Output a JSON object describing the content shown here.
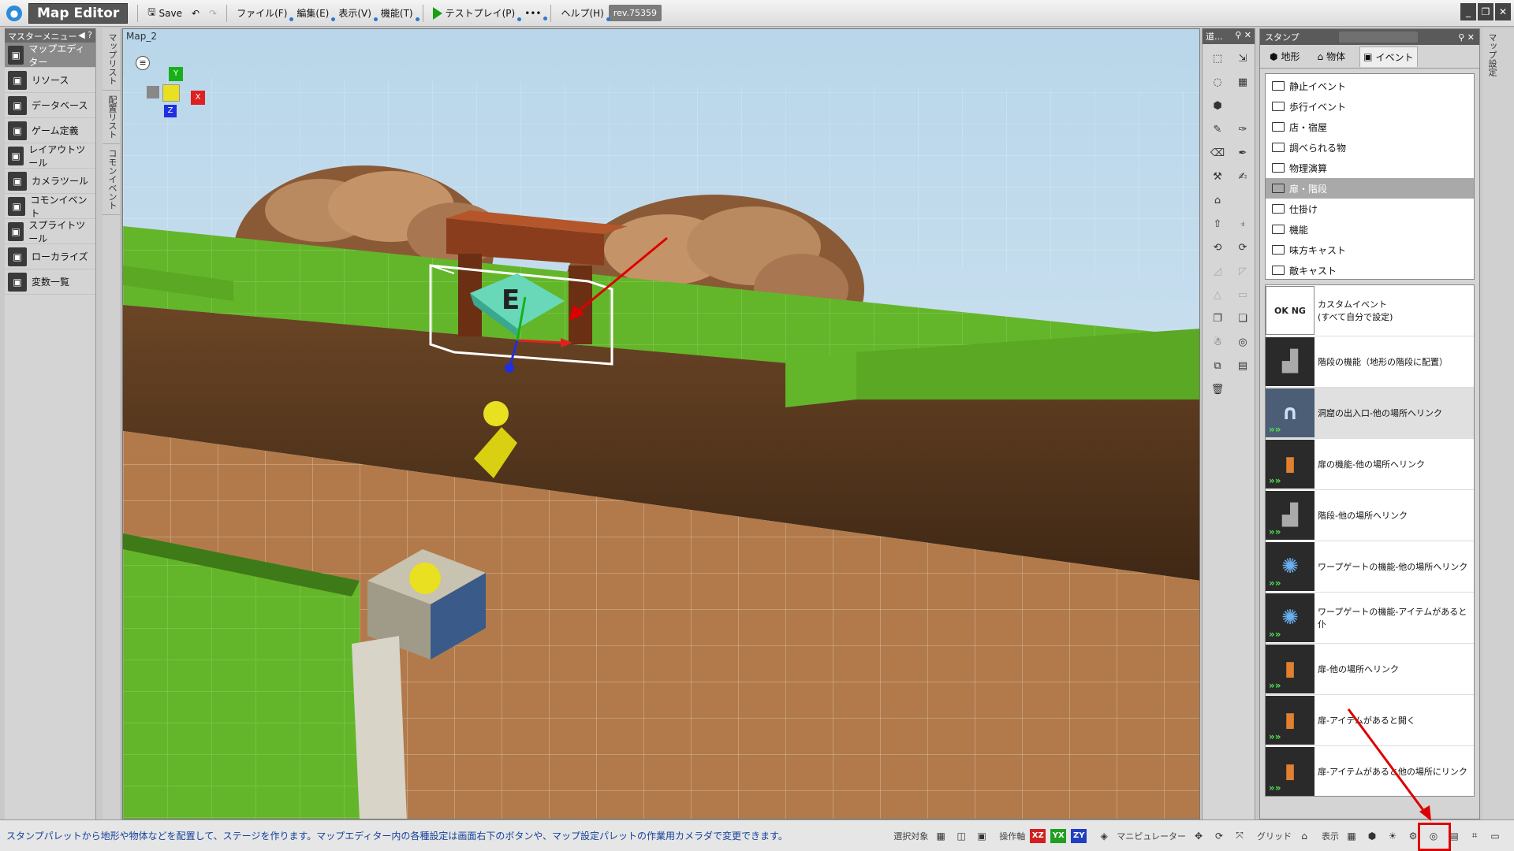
{
  "titlebar": {
    "app_title": "Map Editor",
    "save_label": "Save",
    "menus": [
      "ファイル(F)",
      "編集(E)",
      "表示(V)",
      "機能(T)"
    ],
    "testplay_label": "テストプレイ(P)",
    "more_label": "•••",
    "help_label": "ヘルプ(H)",
    "revision": "rev.75359"
  },
  "master_menu": {
    "title": "マスターメニュー",
    "items": [
      {
        "label": "マップエディター",
        "icon": "map-editor-icon"
      },
      {
        "label": "リソース",
        "icon": "resource-icon"
      },
      {
        "label": "データベース",
        "icon": "database-icon"
      },
      {
        "label": "ゲーム定義",
        "icon": "game-definition-icon"
      },
      {
        "label": "レイアウトツール",
        "icon": "layout-tool-icon"
      },
      {
        "label": "カメラツール",
        "icon": "camera-tool-icon"
      },
      {
        "label": "コモンイベント",
        "icon": "common-event-icon"
      },
      {
        "label": "スプライトツール",
        "icon": "sprite-tool-icon"
      },
      {
        "label": "ローカライズ",
        "icon": "localize-icon"
      },
      {
        "label": "変数一覧",
        "icon": "variables-icon"
      }
    ]
  },
  "side_tabs": [
    "マップリスト",
    "配置リスト",
    "コモンイベント"
  ],
  "viewport": {
    "map_name": "Map_2",
    "gizmo_labels": [
      "Y",
      "X",
      "Z"
    ],
    "event_letter": "E"
  },
  "tool_palette": {
    "title": "道..."
  },
  "stamp": {
    "title": "スタンプ",
    "tabs": [
      "地形",
      "物体",
      "イベント"
    ],
    "categories": [
      "静止イベント",
      "歩行イベント",
      "店・宿屋",
      "調べられる物",
      "物理演算",
      "扉・階段",
      "仕掛け",
      "機能",
      "味方キャスト",
      "敵キャスト"
    ],
    "selected_category": "扉・階段",
    "events": [
      {
        "label": "カスタムイベント\n(すべて自分で設定)",
        "kind": "custom"
      },
      {
        "label": "階段の機能（地形の階段に配置）",
        "kind": "stairs"
      },
      {
        "label": "洞窟の出入口-他の場所へリンク",
        "kind": "cave"
      },
      {
        "label": "扉の機能-他の場所へリンク",
        "kind": "door"
      },
      {
        "label": "階段-他の場所へリンク",
        "kind": "stairs"
      },
      {
        "label": "ワープゲートの機能-他の場所へリンク",
        "kind": "warp"
      },
      {
        "label": "ワープゲートの機能-アイテムがあると仆",
        "kind": "warp"
      },
      {
        "label": "扉-他の場所へリンク",
        "kind": "door"
      },
      {
        "label": "扉-アイテムがあると開く",
        "kind": "door"
      },
      {
        "label": "扉-アイテムがあると他の場所にリンク",
        "kind": "door"
      }
    ]
  },
  "right_side_tab": "マップ設定",
  "statusbar": {
    "message": "スタンプパレットから地形や物体などを配置して、ステージを作ります。マップエディター内の各種設定は画面右下のボタンや、マップ設定パレットの作業用カメラダで変更できます。",
    "select_target_label": "選択対象",
    "axis_label": "操作軸",
    "axis_buttons": [
      "XZ",
      "YX",
      "ZY"
    ],
    "manipulator_label": "マニピュレーター",
    "grid_label": "グリッド",
    "display_label": "表示"
  },
  "colors": {
    "sky": "#cfe4f2",
    "grass": "#63b62a",
    "dirt": "#b27a4a",
    "highlight": "#dd0000",
    "axis_red": "#e02020",
    "axis_green": "#18b018",
    "axis_blue": "#2030e0"
  }
}
